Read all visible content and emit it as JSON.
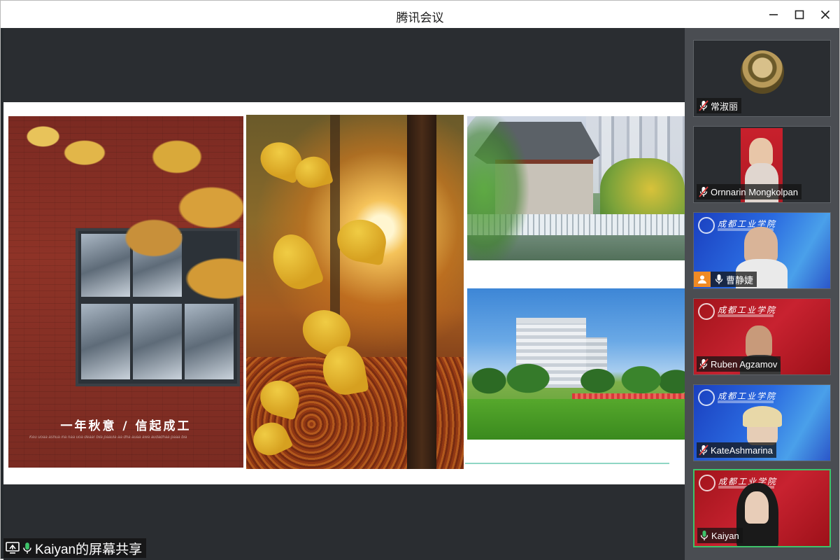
{
  "window": {
    "title": "腾讯会议"
  },
  "slide": {
    "slogan": "一年秋意 / 信起成工",
    "slogan_sub": "Keu uoaa ashua ina naa uoa deaar bila paaula aa dha auaa awa audadhaa paaa bia"
  },
  "participants": [
    {
      "name": "常淑丽",
      "mic": "muted",
      "background": "photo"
    },
    {
      "name": "Ornnarin Mongkolpan",
      "mic": "muted",
      "background": "dark"
    },
    {
      "name": "曹静婕",
      "mic": "on",
      "background": "blue",
      "has_person_icon": true
    },
    {
      "name": "Ruben Agzamov",
      "mic": "muted",
      "background": "red"
    },
    {
      "name": "KateAshmarina",
      "mic": "muted",
      "background": "blue"
    },
    {
      "name": "Kaiyan",
      "mic": "on",
      "background": "red",
      "active_speaker": true
    }
  ],
  "share_label": {
    "text": "Kaiyan的屏幕共享"
  },
  "colors": {
    "active_speaker_border": "#3ec36a",
    "mic_on": "#3ec36a",
    "mic_muted": "#e03c3c",
    "person_icon_bg": "#f08a24",
    "university_red": "#c82230",
    "university_blue": "#2a6ae0"
  }
}
